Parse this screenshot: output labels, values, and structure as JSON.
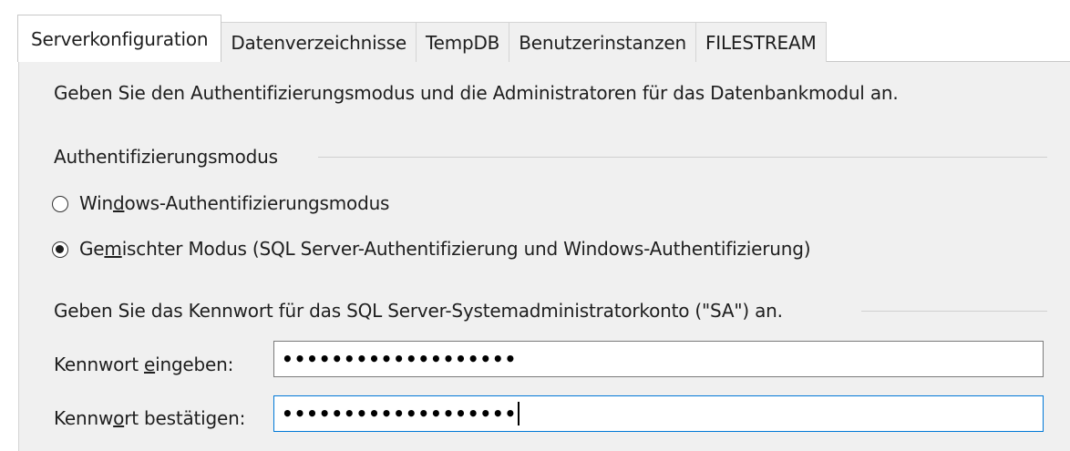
{
  "tabs": [
    {
      "label": "Serverkonfiguration",
      "active": true
    },
    {
      "label": "Datenverzeichnisse",
      "active": false
    },
    {
      "label": "TempDB",
      "active": false
    },
    {
      "label": "Benutzerinstanzen",
      "active": false
    },
    {
      "label": "FILESTREAM",
      "active": false
    }
  ],
  "panel": {
    "description": "Geben Sie den Authentifizierungsmodus und die Administratoren für das Datenbankmodul an.",
    "auth_group_label": "Authentifizierungsmodus",
    "radio_windows": {
      "label_pre": "Win",
      "label_acc": "d",
      "label_post": "ows-Authentifizierungsmodus",
      "checked": false
    },
    "radio_mixed": {
      "label_pre": "Ge",
      "label_acc": "m",
      "label_post": "ischter Modus (SQL Server-Authentifizierung und Windows-Authentifizierung)",
      "checked": true
    },
    "sa_group_label": "Geben Sie das Kennwort für das SQL Server-Systemadministratorkonto (\"SA\") an.",
    "password_label": {
      "pre": "Kennwort ",
      "acc": "e",
      "post": "ingeben:"
    },
    "password_value": "•••••••••••••••••••",
    "confirm_label": {
      "pre": "Kennw",
      "acc": "o",
      "post": "rt bestätigen:"
    },
    "confirm_value": "•••••••••••••••••••"
  },
  "colors": {
    "panel_bg": "#f0f0f0",
    "focus_border": "#0078d7",
    "input_border": "#7a7a7a"
  }
}
